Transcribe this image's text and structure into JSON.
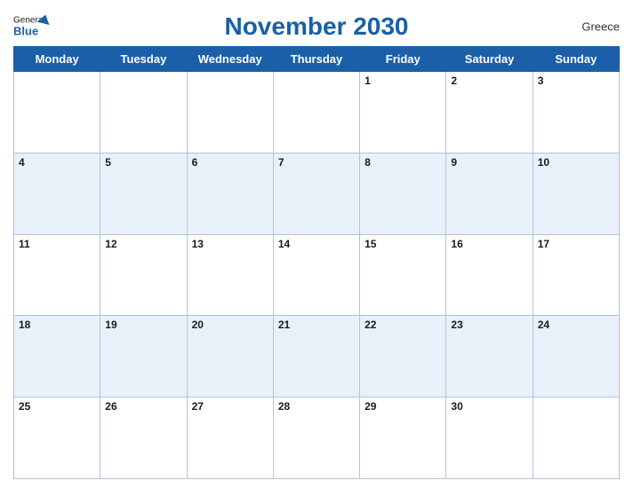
{
  "header": {
    "title": "November 2030",
    "country": "Greece",
    "logo_general": "General",
    "logo_blue": "Blue"
  },
  "weekdays": [
    "Monday",
    "Tuesday",
    "Wednesday",
    "Thursday",
    "Friday",
    "Saturday",
    "Sunday"
  ],
  "weeks": [
    [
      null,
      null,
      null,
      null,
      1,
      2,
      3
    ],
    [
      4,
      5,
      6,
      7,
      8,
      9,
      10
    ],
    [
      11,
      12,
      13,
      14,
      15,
      16,
      17
    ],
    [
      18,
      19,
      20,
      21,
      22,
      23,
      24
    ],
    [
      25,
      26,
      27,
      28,
      29,
      30,
      null
    ]
  ]
}
